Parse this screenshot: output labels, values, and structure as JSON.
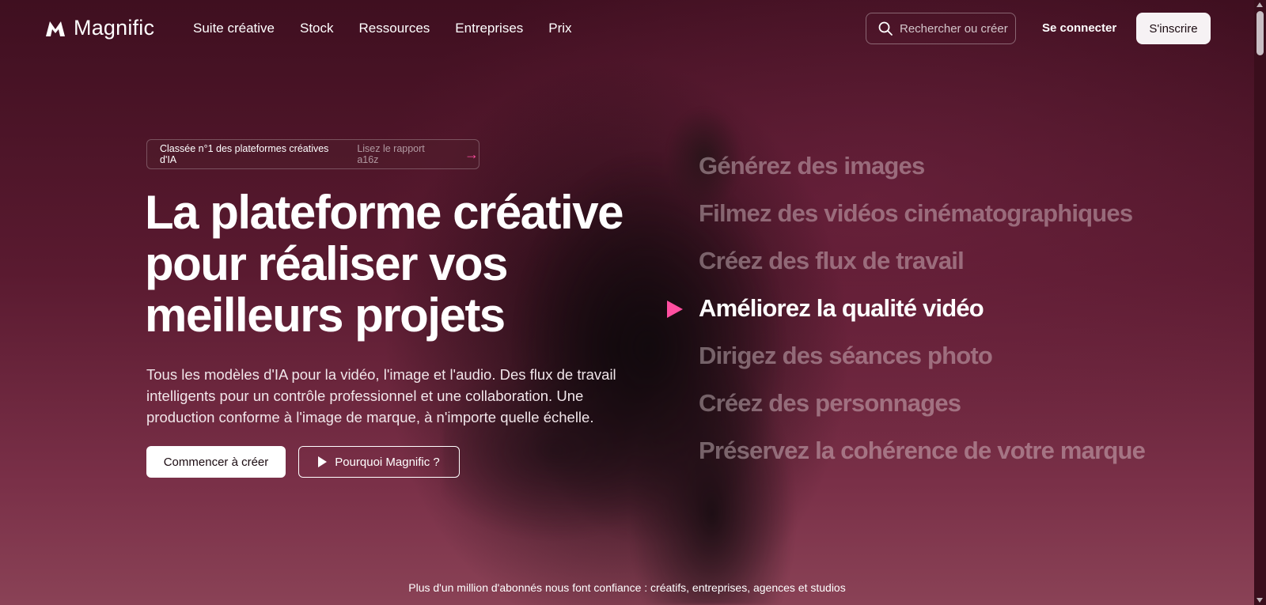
{
  "brand": {
    "name": "Magnific",
    "accent": "#ff4fa0"
  },
  "nav": {
    "items": [
      "Suite créative",
      "Stock",
      "Ressources",
      "Entreprises",
      "Prix"
    ]
  },
  "search": {
    "label": "Rechercher ou créer",
    "icon": "search-icon"
  },
  "auth": {
    "login": "Se connecter",
    "signup": "S'inscrire"
  },
  "hero": {
    "badge": {
      "text": "Classée n°1 des plateformes créatives d'IA",
      "link": "Lisez le rapport a16z",
      "icon": "arrow-right-icon"
    },
    "headline_lines": [
      "La plateforme créative",
      "pour réaliser vos",
      "meilleurs projets"
    ],
    "subtitle": "Tous les modèles d'IA pour la vidéo, l'image et l'audio. Des flux de travail intelligents pour un contrôle professionnel et une collaboration. Une production conforme à l'image de marque, à n'importe quelle échelle.",
    "primary_cta": "Commencer à créer",
    "secondary_cta": "Pourquoi Magnific ?"
  },
  "features": {
    "items": [
      "Générez des images",
      "Filmez des vidéos cinématographiques",
      "Créez des flux de travail",
      "Améliorez la qualité vidéo",
      "Dirigez des séances photo",
      "Créez des personnages",
      "Préservez la cohérence de votre marque"
    ],
    "active_index": 3
  },
  "footer_note": "Plus d'un million d'abonnés nous font confiance : créatifs, entreprises, agences et studios"
}
